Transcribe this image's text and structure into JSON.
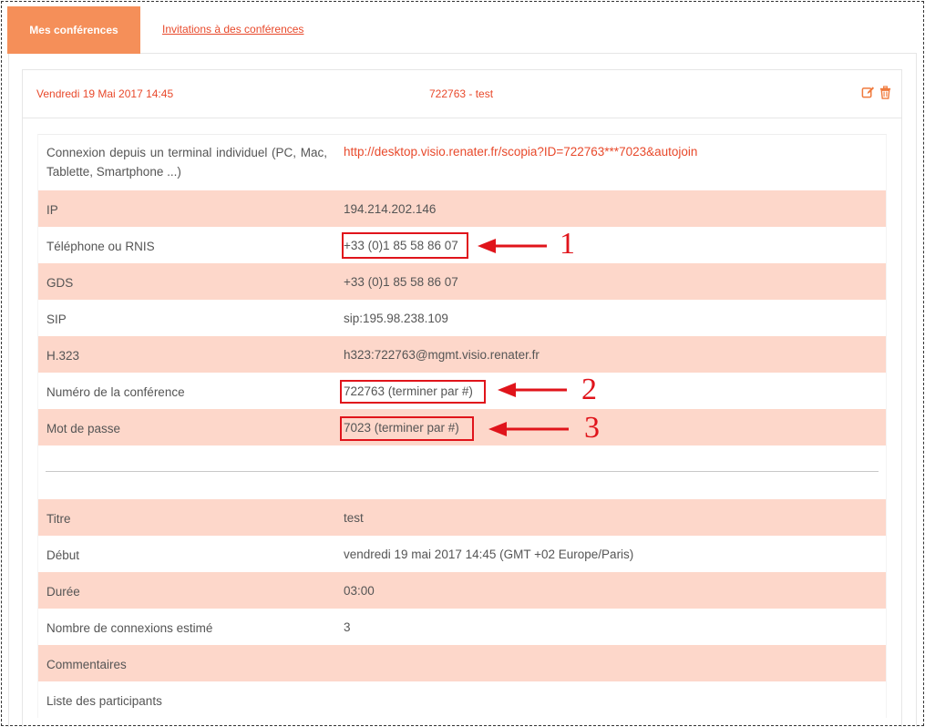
{
  "tabs": {
    "active_label": "Mes conférences",
    "link_label": "Invitations à des conférences"
  },
  "conference": {
    "date": "Vendredi 19 Mai 2017 14:45",
    "title": "722763 - test",
    "icons": [
      "edit-icon",
      "trash-icon"
    ],
    "accent_color": "#f58f59",
    "link_color": "#e8492b",
    "row_pink": "#fdd7ca"
  },
  "details": [
    {
      "label": "Connexion depuis un terminal individuel (PC, Mac, Tablette, Smartphone ...)",
      "value": "http://desktop.visio.renater.fr/scopia?ID=722763***7023&autojoin"
    },
    {
      "label": "IP",
      "value": "194.214.202.146"
    },
    {
      "label": "Téléphone ou RNIS",
      "value": "+33 (0)1 85 58 86 07"
    },
    {
      "label": "GDS",
      "value": "+33 (0)1 85 58 86 07"
    },
    {
      "label": "SIP",
      "value": "sip:195.98.238.109"
    },
    {
      "label": "H.323",
      "value": "h323:722763@mgmt.visio.renater.fr"
    },
    {
      "label": "Numéro de la conférence",
      "value": "722763 (terminer par #)"
    },
    {
      "label": "Mot de passe",
      "value": "7023 (terminer par #)"
    }
  ],
  "info": [
    {
      "label": "Titre",
      "value": "test"
    },
    {
      "label": "Début",
      "value": "vendredi 19 mai 2017 14:45 (GMT +02 Europe/Paris)"
    },
    {
      "label": "Durée",
      "value": "03:00"
    },
    {
      "label": "Nombre de connexions estimé",
      "value": "3"
    },
    {
      "label": "Commentaires",
      "value": ""
    },
    {
      "label": "Liste des participants",
      "value": ""
    }
  ],
  "annotations": {
    "color": "#e0141b",
    "numbers": [
      "1",
      "2",
      "3"
    ]
  }
}
